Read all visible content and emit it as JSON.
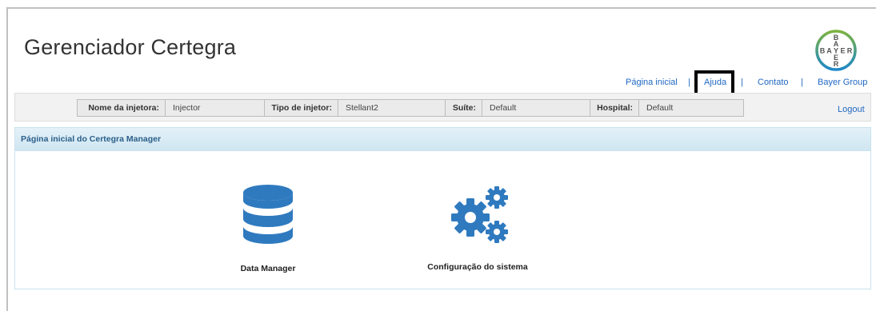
{
  "app": {
    "title": "Gerenciador Certegra"
  },
  "logo": {
    "letters_vertical": [
      "B",
      "A",
      "Y",
      "E",
      "R"
    ],
    "letters_horizontal": "BAYER",
    "colors": {
      "ring_top": "#7cb342",
      "ring_bottom": "#1e88c8"
    }
  },
  "topnav": {
    "items": [
      {
        "label": "Página inicial"
      },
      {
        "label": "Ajuda"
      },
      {
        "label": "Contato"
      },
      {
        "label": "Bayer Group"
      }
    ],
    "separator": "|"
  },
  "infobar": {
    "fields": [
      {
        "label": "Nome da injetora:",
        "value": "Injector"
      },
      {
        "label": "Tipo de injetor:",
        "value": "Stellant2"
      },
      {
        "label": "Suíte:",
        "value": "Default"
      },
      {
        "label": "Hospital:",
        "value": "Default"
      }
    ],
    "logout": "Logout"
  },
  "panel": {
    "title": "Página inicial do Certegra Manager",
    "tiles": [
      {
        "label": "Data Manager",
        "icon": "database-icon"
      },
      {
        "label": "Configuração do sistema",
        "icon": "gears-icon"
      }
    ]
  },
  "colors": {
    "icon_blue": "#2f7abf",
    "link_blue": "#2168c2"
  }
}
